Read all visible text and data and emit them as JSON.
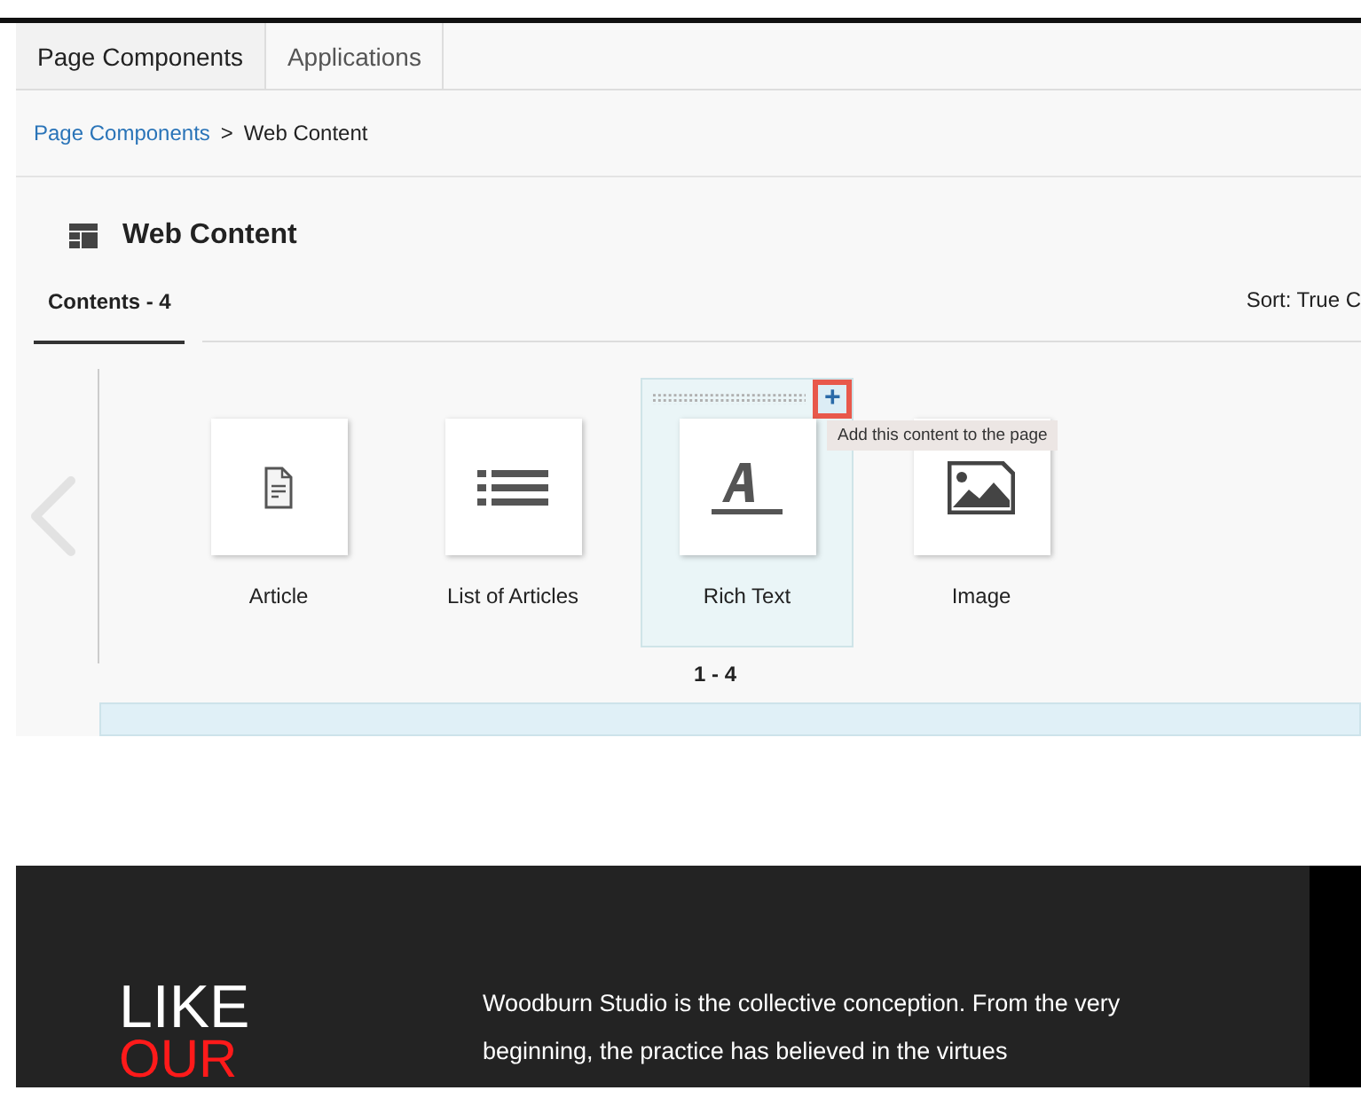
{
  "tabs": [
    {
      "label": "Page Components",
      "selected": true
    },
    {
      "label": "Applications",
      "selected": false
    }
  ],
  "breadcrumb": {
    "link": "Page Components",
    "separator": ">",
    "current": "Web Content"
  },
  "panel": {
    "title": "Web Content",
    "subtab": "Contents - 4",
    "sort": "Sort: True C"
  },
  "items": [
    {
      "kind": "article",
      "label": "Article",
      "selected": false
    },
    {
      "kind": "list",
      "label": "List of Articles",
      "selected": false
    },
    {
      "kind": "richtext",
      "label": "Rich Text",
      "selected": true
    },
    {
      "kind": "image",
      "label": "Image",
      "selected": false
    }
  ],
  "add_button": {
    "label": "+",
    "tooltip": "Add this content to the page"
  },
  "pager": "1 - 4",
  "preview": {
    "heading": "LIKE",
    "heading_accent": "OUR",
    "text": "Woodburn Studio is the collective conception. From the very beginning, the practice has believed in the virtues"
  }
}
